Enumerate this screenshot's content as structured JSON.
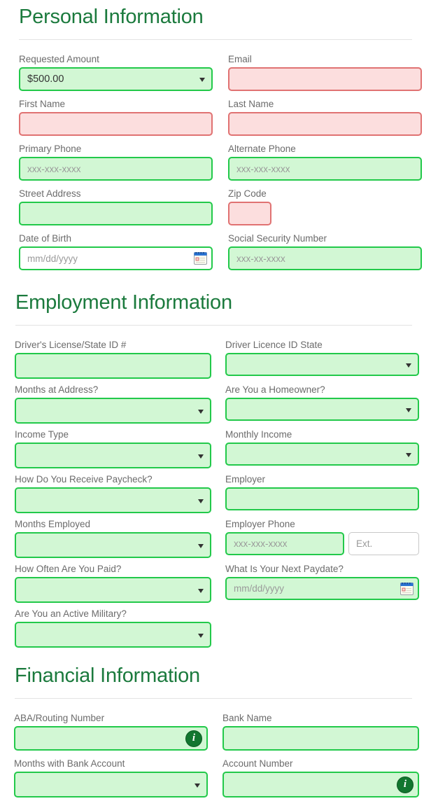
{
  "theme": {
    "heading_color": "#1b7a3d",
    "valid_border": "#22c94a",
    "valid_fill": "#d2f7d4",
    "invalid_border": "#e07272",
    "invalid_fill": "#fcdede",
    "neutral_border": "#c8c8c8",
    "label_color": "#6b6b6b",
    "info_badge_color": "#12762f"
  },
  "sections": [
    {
      "id": "personal",
      "title": "Personal Information",
      "fields": {
        "requested_amount": {
          "label": "Requested Amount",
          "value": "$500.00"
        },
        "email": {
          "label": "Email",
          "value": ""
        },
        "first_name": {
          "label": "First Name",
          "value": ""
        },
        "last_name": {
          "label": "Last Name",
          "value": ""
        },
        "primary_phone": {
          "label": "Primary Phone",
          "placeholder": "xxx-xxx-xxxx"
        },
        "alternate_phone": {
          "label": "Alternate Phone",
          "placeholder": "xxx-xxx-xxxx"
        },
        "street_address": {
          "label": "Street Address",
          "value": ""
        },
        "zip_code": {
          "label": "Zip Code",
          "value": ""
        },
        "date_of_birth": {
          "label": "Date of Birth",
          "placeholder": "mm/dd/yyyy"
        },
        "ssn": {
          "label": "Social Security Number",
          "placeholder": "xxx-xx-xxxx"
        }
      }
    },
    {
      "id": "employment",
      "title": "Employment Information",
      "fields": {
        "drivers_license": {
          "label": "Driver's License/State ID #",
          "value": ""
        },
        "license_state": {
          "label": "Driver Licence ID State",
          "value": ""
        },
        "months_at_address": {
          "label": "Months at Address?",
          "value": ""
        },
        "homeowner": {
          "label": "Are You a Homeowner?",
          "value": ""
        },
        "income_type": {
          "label": "Income Type",
          "value": ""
        },
        "monthly_income": {
          "label": "Monthly Income",
          "value": ""
        },
        "paycheck_method": {
          "label": "How Do You Receive Paycheck?",
          "value": ""
        },
        "employer": {
          "label": "Employer",
          "value": ""
        },
        "months_employed": {
          "label": "Months Employed",
          "value": ""
        },
        "employer_phone": {
          "label": "Employer Phone",
          "placeholder": "xxx-xxx-xxxx"
        },
        "employer_phone_ext": {
          "placeholder": "Ext."
        },
        "pay_frequency": {
          "label": "How Often Are You Paid?",
          "value": ""
        },
        "next_paydate": {
          "label": "What Is Your Next Paydate?",
          "placeholder": "mm/dd/yyyy"
        },
        "active_military": {
          "label": "Are You an Active Military?",
          "value": ""
        }
      }
    },
    {
      "id": "financial",
      "title": "Financial Information",
      "fields": {
        "routing_number": {
          "label": "ABA/Routing Number",
          "value": "",
          "info": "i"
        },
        "bank_name": {
          "label": "Bank Name",
          "value": ""
        },
        "months_with_bank": {
          "label": "Months with Bank Account",
          "value": ""
        },
        "account_number": {
          "label": "Account Number",
          "value": "",
          "info": "i"
        }
      }
    }
  ]
}
